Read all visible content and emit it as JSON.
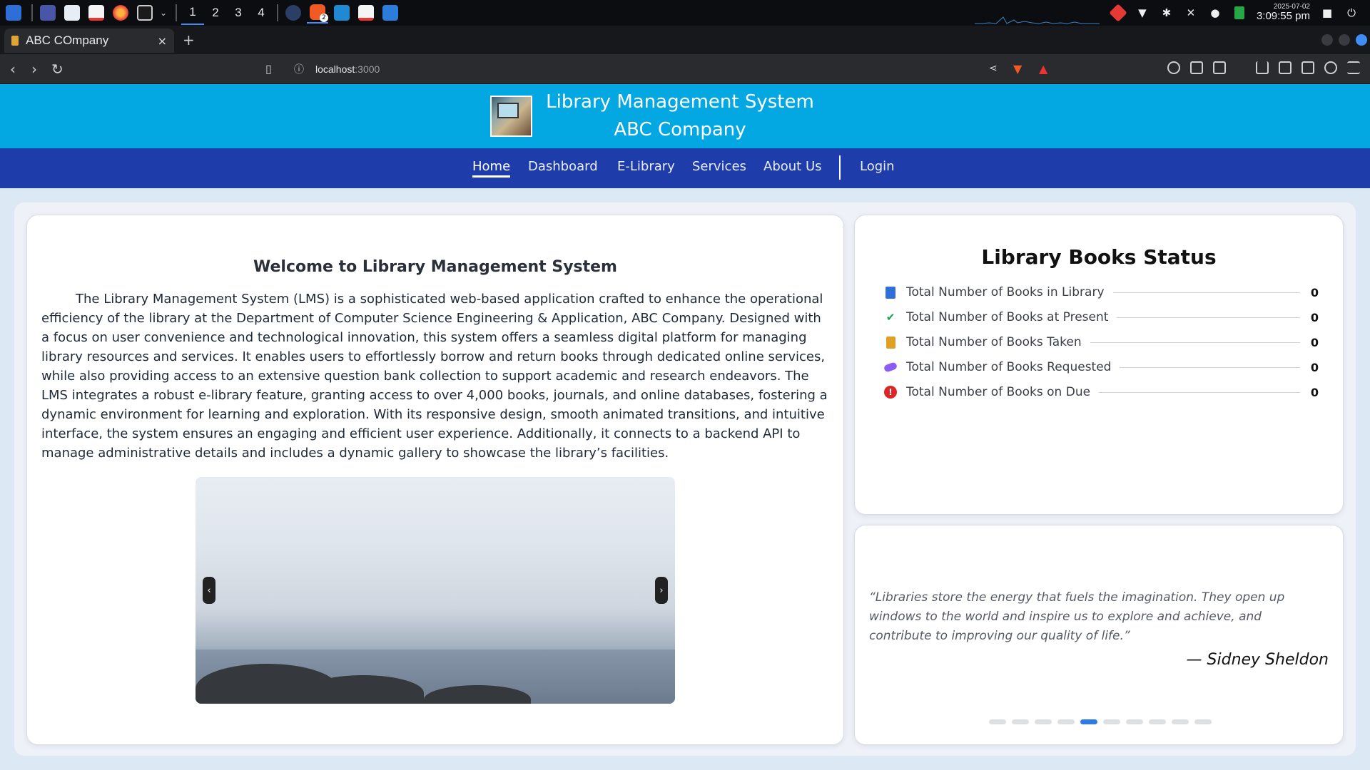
{
  "os": {
    "workspaces": [
      "1",
      "2",
      "3",
      "4"
    ],
    "active_workspace": "1",
    "clock_date": "2025-07-02",
    "clock_time": "3:09:55 pm",
    "taskbar_apps": [
      "app-launcher-icon",
      "desktop-icon",
      "file-manager-icon",
      "pdf-icon",
      "firefox-icon",
      "terminal-icon",
      "chevron-down-icon",
      "info-icon",
      "brave-icon",
      "vscode-icon",
      "pdf-icon",
      "downloads-icon"
    ],
    "brave_badge": "2"
  },
  "browser": {
    "tab_title": "ABC COmpany",
    "close_tab": "×",
    "new_tab": "+",
    "url_host": "localhost",
    "url_port": ":3000",
    "accent": "#3f8ef5"
  },
  "site": {
    "title_line1": "Library Management System",
    "title_line2": "ABC Company",
    "banner_color": "#03a8e2",
    "nav_color": "#1e3dab",
    "nav": [
      {
        "label": "Home",
        "active": true
      },
      {
        "label": "Dashboard",
        "active": false
      },
      {
        "label": "E-Library",
        "active": false
      },
      {
        "label": "Services",
        "active": false
      },
      {
        "label": "About Us",
        "active": false
      },
      {
        "label": "Login",
        "active": false
      }
    ]
  },
  "welcome": {
    "title": "Welcome to Library Management System",
    "body": "The Library Management System (LMS) is a sophisticated web-based application crafted to enhance the operational efficiency of the library at the Department of Computer Science Engineering & Application, ABC Company. Designed with a focus on user convenience and technological innovation, this system offers a seamless digital platform for managing library resources and services. It enables users to effortlessly borrow and return books through dedicated online services, while also providing access to an extensive question bank collection to support academic and research endeavors. The LMS integrates a robust e-library feature, granting access to over 4,000 books, journals, and online databases, fostering a dynamic environment for learning and exploration. With its responsive design, smooth animated transitions, and intuitive interface, the system ensures an engaging and efficient user experience. Additionally, it connects to a backend API to manage administrative details and includes a dynamic gallery to showcase the library’s facilities.",
    "prev": "‹",
    "next": "›"
  },
  "status": {
    "title": "Library Books Status",
    "rows": [
      {
        "label": "Total Number of Books in Library",
        "value": "0",
        "icon": "book-icon",
        "color": "#2f6fde"
      },
      {
        "label": "Total Number of Books at Present",
        "value": "0",
        "icon": "check-icon",
        "color": "#16a34a"
      },
      {
        "label": "Total Number of Books Taken",
        "value": "0",
        "icon": "clipboard-icon",
        "color": "#e0a123"
      },
      {
        "label": "Total Number of Books Requested",
        "value": "0",
        "icon": "handshake-icon",
        "color": "#8b5cf6"
      },
      {
        "label": "Total Number of Books on Due",
        "value": "0",
        "icon": "alert-icon",
        "color": "#dc2626"
      }
    ]
  },
  "quote": {
    "text": "“Libraries store the energy that fuels the imagination. They open up windows to the world and inspire us to explore and achieve, and contribute to improving our quality of life.”",
    "author": "— Sidney Sheldon",
    "dots_total": 10,
    "active_dot": 5
  }
}
